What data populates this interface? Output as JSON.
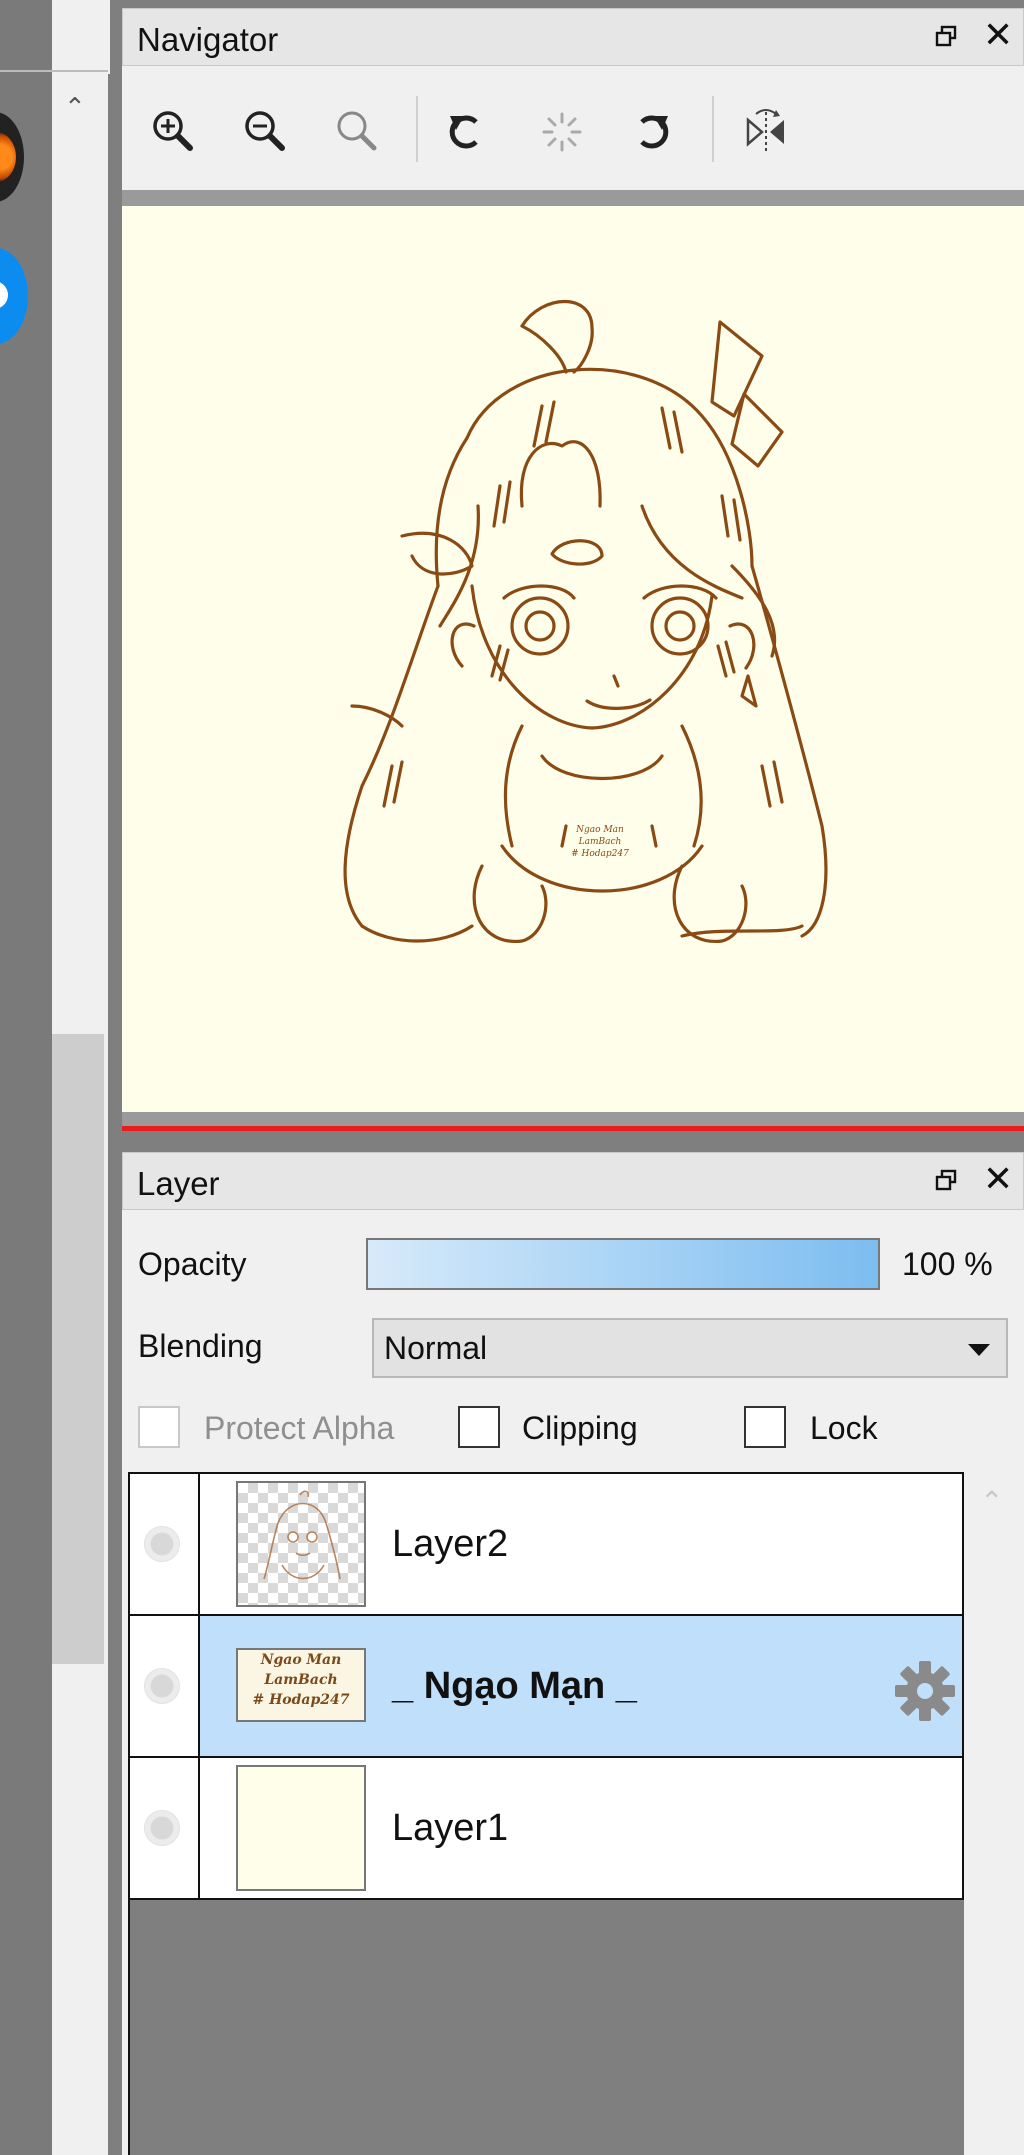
{
  "colors": {
    "panel_bg": "#f0f0f0",
    "canvas_bg": "#fefeea",
    "sketch_line": "#8a4a14",
    "selected_row": "#bfdffa",
    "opacity_fill": "#7cbdf0",
    "accent_red": "#e81c1c"
  },
  "toolbar_side": {
    "scroll_up_icon": "chevron-up-icon",
    "tools": [
      "orange-brush-tool-icon",
      "blue-tool-icon"
    ]
  },
  "navigator": {
    "title": "Navigator",
    "float_icon": "float-window-icon",
    "close_glyph": "✕",
    "tools": [
      {
        "name": "zoom-in-icon"
      },
      {
        "name": "zoom-out-icon"
      },
      {
        "name": "zoom-reset-icon"
      },
      {
        "name": "rotate-left-icon"
      },
      {
        "name": "rotate-reset-icon"
      },
      {
        "name": "rotate-right-icon"
      },
      {
        "name": "flip-horizontal-icon"
      }
    ],
    "preview": {
      "watermark_lines": [
        "Ngao Man",
        "LamBach",
        "# Hodap247"
      ]
    }
  },
  "layer_panel": {
    "title": "Layer",
    "close_glyph": "✕",
    "opacity_label": "Opacity",
    "opacity_value": "100 %",
    "opacity_fraction": 1.0,
    "blending_label": "Blending",
    "blending_value": "Normal",
    "protect_alpha_label": "Protect Alpha",
    "protect_alpha_checked": false,
    "protect_alpha_enabled": false,
    "clipping_label": "Clipping",
    "clipping_checked": false,
    "lock_label": "Lock",
    "lock_checked": false,
    "layers": [
      {
        "name": "Layer2",
        "visible": false,
        "selected": false,
        "thumbnail": "sketch"
      },
      {
        "name": "_ Ngạo Mạn _",
        "visible": false,
        "selected": true,
        "thumbnail": "watermark",
        "thumb_lines": [
          "Ngao Man",
          "LamBach",
          "# Hodap247"
        ],
        "settings_icon": "gear-icon"
      },
      {
        "name": "Layer1",
        "visible": false,
        "selected": false,
        "thumbnail": "paper"
      }
    ],
    "scroll_up_icon": "chevron-up-icon"
  }
}
